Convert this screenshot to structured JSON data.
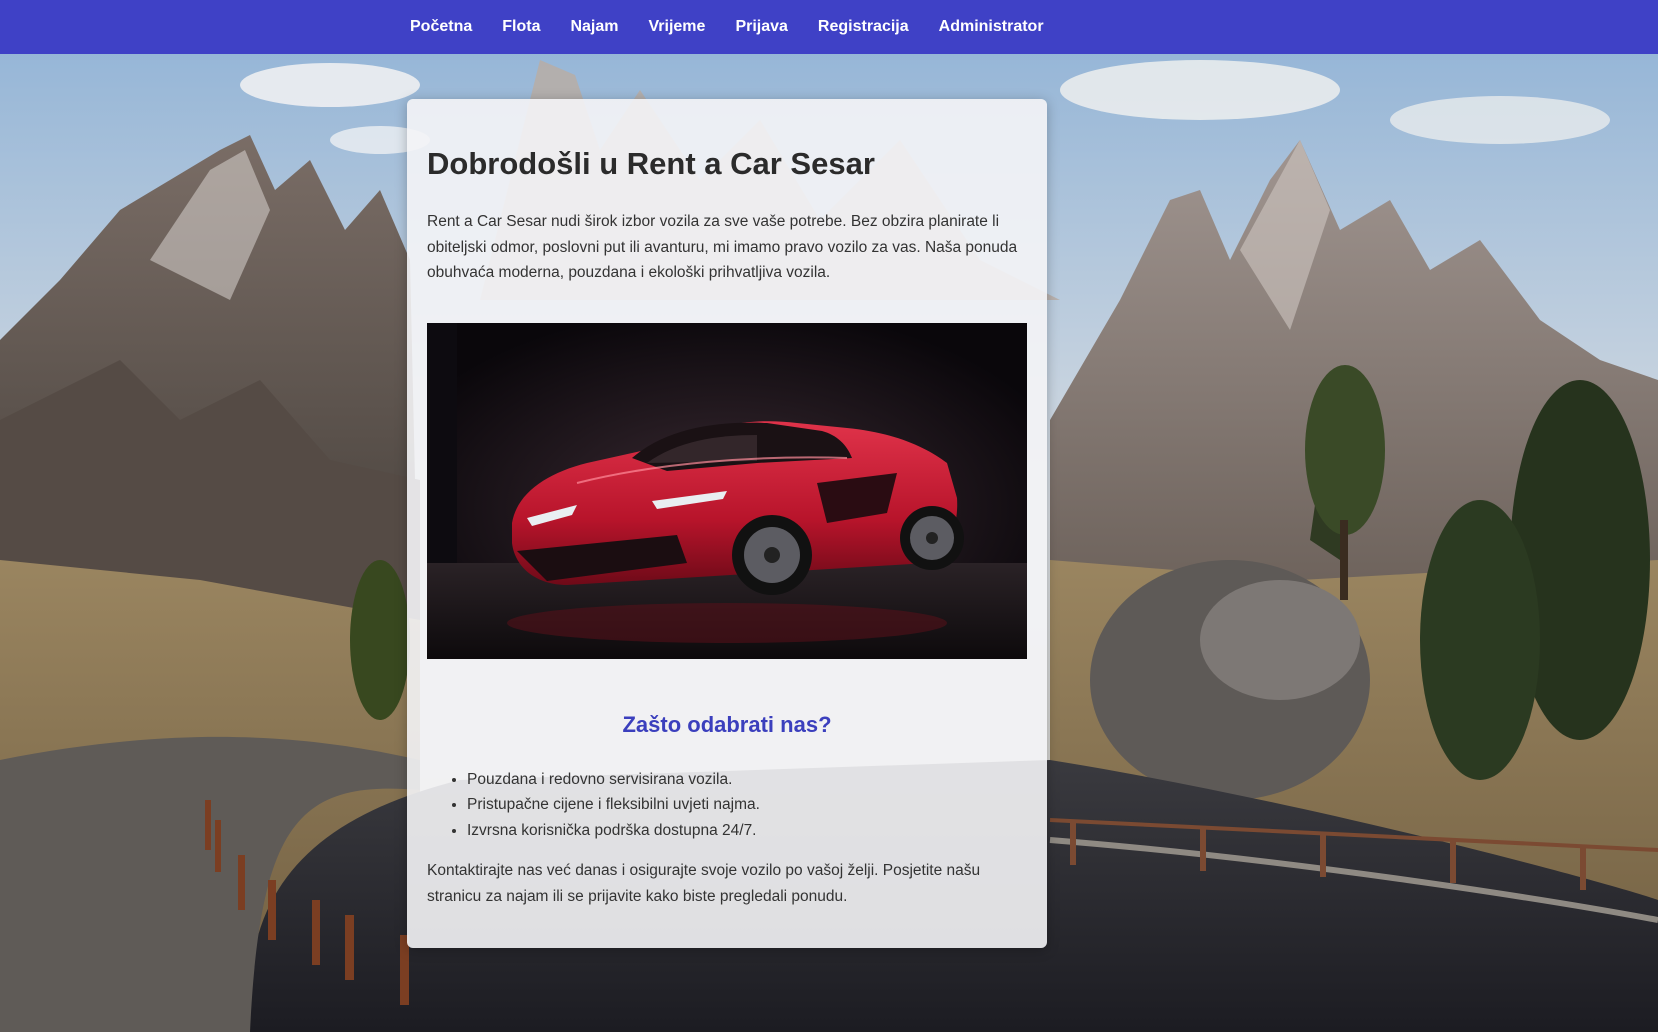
{
  "nav": {
    "items": [
      {
        "label": "Početna"
      },
      {
        "label": "Flota"
      },
      {
        "label": "Najam"
      },
      {
        "label": "Vrijeme"
      },
      {
        "label": "Prijava"
      },
      {
        "label": "Registracija"
      },
      {
        "label": "Administrator"
      }
    ]
  },
  "main": {
    "title": "Dobrodošli u Rent a Car Sesar",
    "intro": "Rent a Car Sesar nudi širok izbor vozila za sve vaše potrebe. Bez obzira planirate li obiteljski odmor, poslovni put ili avanturu, mi imamo pravo vozilo za vas. Naša ponuda obuhvaća moderna, pouzdana i ekološki prihvatljiva vozila.",
    "hero_image": "red-sports-car-image",
    "why_title": "Zašto odabrati nas?",
    "reasons": [
      "Pouzdana i redovno servisirana vozila.",
      "Pristupačne cijene i fleksibilni uvjeti najma.",
      "Izvrsna korisnička podrška dostupna 24/7."
    ],
    "outro": "Kontaktirajte nas već danas i osigurajte svoje vozilo po vašoj želji. Posjetite našu stranicu za najam ili se prijavite kako biste pregledali ponudu."
  },
  "theme": {
    "nav_bg": "#3f41c6",
    "accent": "#3b3fbd",
    "text": "#333333"
  }
}
